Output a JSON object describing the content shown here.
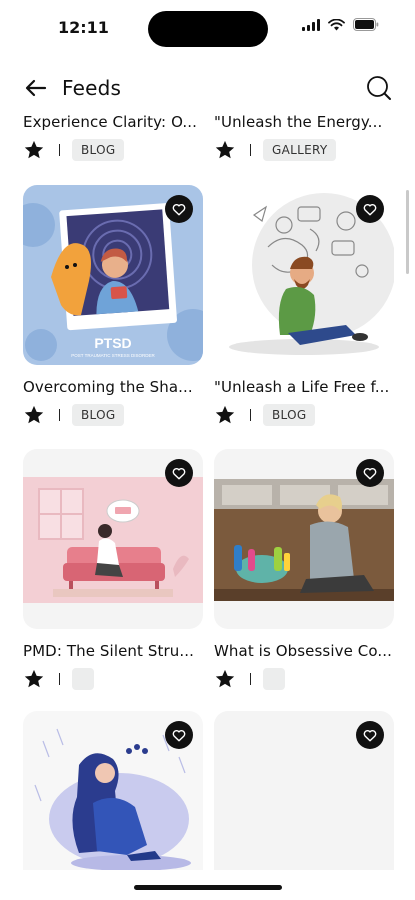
{
  "status": {
    "time": "12:11"
  },
  "header": {
    "title": "Feeds"
  },
  "feed": {
    "items": [
      {
        "title": "Experience Clarity: O...",
        "tag": "BLOG"
      },
      {
        "title": "\"Unleash the Energy...",
        "tag": "GALLERY"
      },
      {
        "title": "Overcoming the Sha...",
        "tag": "BLOG",
        "image": {
          "label": "PTSD",
          "sublabel": "POST TRAUMATIC STRESS DISORDER"
        }
      },
      {
        "title": "\"Unleash a Life Free f...",
        "tag": "BLOG"
      },
      {
        "title": "PMD: The Silent Stru...",
        "tag": ""
      },
      {
        "title": "What is Obsessive Co...",
        "tag": ""
      },
      {
        "title": "",
        "tag": ""
      },
      {
        "title": "",
        "tag": ""
      }
    ]
  }
}
